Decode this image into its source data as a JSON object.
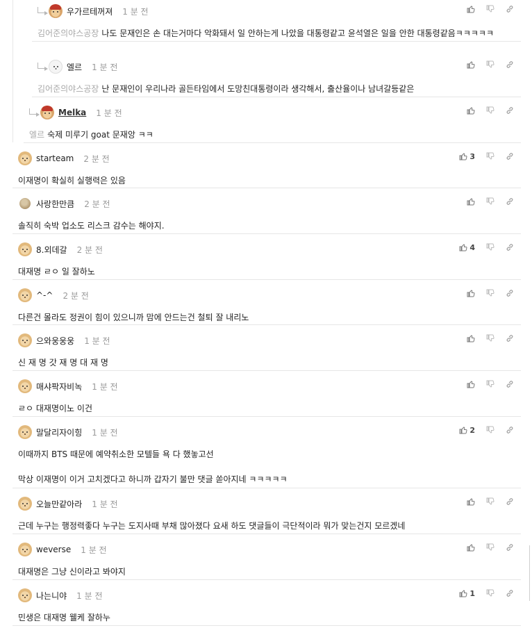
{
  "comments": [
    {
      "level": 1,
      "avatar": "cap-dog-avatar",
      "nick": "우가르테꺼져",
      "time": "1 분 전",
      "mention": "김어준의야스공장",
      "lines": [
        "나도 문재인은 손 대는거마다 악화돼서 일 안하는게 나았을 대통령같고 윤석열은 일을 안한 대통령같음ㅋㅋㅋㅋㅋ"
      ],
      "likes": ""
    },
    {
      "level": 1,
      "avatar": "white-dog-avatar",
      "nick": "엘르",
      "time": "1 분 전",
      "mention": "김어준의야스공장",
      "lines": [
        "난 문재인이 우리나라 골든타임에서 도망친대통령이라 생각해서, 출산율이나 남녀갈등같은"
      ],
      "likes": ""
    },
    {
      "level": 2,
      "avatar": "cap-dog-avatar",
      "nick": "Melka",
      "time": "1 분 전",
      "mention": "엘르",
      "lines": [
        "숙제 미루기 goat 문재앙 ㅋㅋ"
      ],
      "likes": ""
    },
    {
      "level": 0,
      "avatar": "dog-avatar",
      "nick": "starteam",
      "time": "2 분 전",
      "mention": "",
      "lines": [
        "이재명이 확실히 실행력은 있음"
      ],
      "likes": "3"
    },
    {
      "level": 0,
      "avatar": "brown-avatar",
      "nick": "사랑한만큼",
      "time": "2 분 전",
      "mention": "",
      "lines": [
        "솔직히 숙박 업소도 리스크 감수는 해야지."
      ],
      "likes": ""
    },
    {
      "level": 0,
      "avatar": "dog-avatar",
      "nick": "8.외데갈",
      "time": "2 분 전",
      "mention": "",
      "lines": [
        "대재명 ㄹㅇ 일 잘하노"
      ],
      "likes": "4"
    },
    {
      "level": 0,
      "avatar": "dog-avatar",
      "nick": "^-^",
      "time": "2 분 전",
      "mention": "",
      "lines": [
        "다른건 몰라도 정권이 힘이 있으니까 맘에 안드는건 철퇴 잘 내리노"
      ],
      "likes": ""
    },
    {
      "level": 0,
      "avatar": "dog-avatar",
      "nick": "으와웅웅웅",
      "time": "1 분 전",
      "mention": "",
      "lines": [
        "신 재 명 갓 재 명 대 재 명"
      ],
      "likes": ""
    },
    {
      "level": 0,
      "avatar": "dog-avatar",
      "nick": "매샤팍자비녹",
      "time": "1 분 전",
      "mention": "",
      "lines": [
        "ㄹㅇ 대재명이노 이건"
      ],
      "likes": ""
    },
    {
      "level": 0,
      "avatar": "dog-avatar",
      "nick": "말달리자이힝",
      "time": "1 분 전",
      "mention": "",
      "lines": [
        "이때까지 BTS 때문에 예약취소한 모텔들 욕 다 했놓고선",
        "막상 이재명이 이거 고치겠다고 하니까 갑자기 불만 댓글 쏟아지네 ㅋㅋㅋㅋㅋ"
      ],
      "likes": "2"
    },
    {
      "level": 0,
      "avatar": "dog-avatar",
      "nick": "오늘만같아라",
      "time": "1 분 전",
      "mention": "",
      "lines": [
        "근데 누구는 행정력좋다 누구는 도지사때 부채 많아졌다 요새 하도 댓글들이 극단적이라 뭐가 맞는건지 모르겠네"
      ],
      "likes": ""
    },
    {
      "level": 0,
      "avatar": "dog-avatar",
      "nick": "weverse",
      "time": "1 분 전",
      "mention": "",
      "lines": [
        "대재명은 그냥 신이라고 봐야지"
      ],
      "likes": ""
    },
    {
      "level": 0,
      "avatar": "dog-avatar",
      "nick": "나는니야",
      "time": "1 분 전",
      "mention": "",
      "lines": [
        "민생은 대재명 웰케 잘하누"
      ],
      "likes": "1"
    }
  ],
  "colors": {
    "mention": "#a8a8a8",
    "time": "#9a9a9a",
    "divider": "#e6e6e6"
  },
  "icons": {
    "like": "thumbs-up-icon",
    "dislike": "thumbs-down-icon",
    "share": "link-icon",
    "reply": "reply-arrow-icon"
  }
}
